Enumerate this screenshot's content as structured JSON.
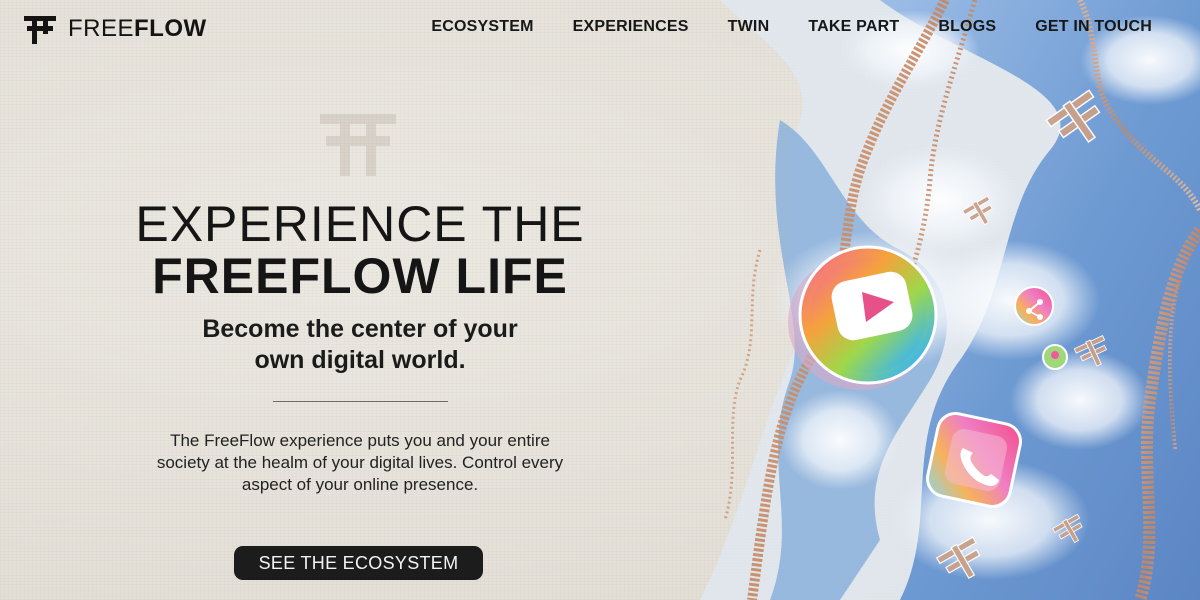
{
  "brand": {
    "name_light": "FREE",
    "name_bold": "FLOW"
  },
  "nav": {
    "items": [
      {
        "label": "ECOSYSTEM"
      },
      {
        "label": "EXPERIENCES"
      },
      {
        "label": "TWIN"
      },
      {
        "label": "TAKE PART"
      },
      {
        "label": "BLOGS"
      },
      {
        "label": "GET IN TOUCH"
      }
    ]
  },
  "hero": {
    "title_line1": "EXPERIENCE THE",
    "title_line2": "FREEFLOW LIFE",
    "tagline": "Become the center of your own digital world.",
    "body": "The FreeFlow experience puts you and your entire society at the healm of your digital lives. Control every aspect of your online presence.",
    "cta_label": "SEE THE ECOSYSTEM"
  },
  "colors": {
    "text_dark": "#151515",
    "button_bg": "#1c1c1c",
    "paper_bg": "#e9e6df",
    "water_blue": "#7fa6d6",
    "glitter_copper": "#c98e6a"
  },
  "icons": [
    "freeflow-logo-icon",
    "youtube-icon",
    "share-icon",
    "phone-icon",
    "location-pin-icon",
    "freeflow-glyph-icon"
  ]
}
